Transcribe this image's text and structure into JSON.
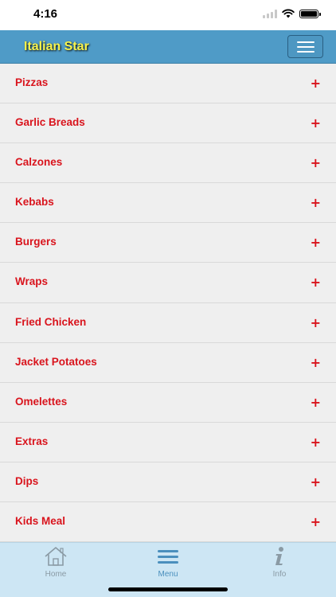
{
  "status_bar": {
    "time": "4:16"
  },
  "header": {
    "title": "Italian Star",
    "menu_toggle_icon": "hamburger-icon"
  },
  "menu": {
    "items": [
      {
        "label": "Pizzas",
        "expand": "+"
      },
      {
        "label": "Garlic Breads",
        "expand": "+"
      },
      {
        "label": "Calzones",
        "expand": "+"
      },
      {
        "label": "Kebabs",
        "expand": "+"
      },
      {
        "label": "Burgers",
        "expand": "+"
      },
      {
        "label": "Wraps",
        "expand": "+"
      },
      {
        "label": "Fried Chicken",
        "expand": "+"
      },
      {
        "label": "Jacket Potatoes",
        "expand": "+"
      },
      {
        "label": "Omelettes",
        "expand": "+"
      },
      {
        "label": "Extras",
        "expand": "+"
      },
      {
        "label": "Dips",
        "expand": "+"
      },
      {
        "label": "Kids Meal",
        "expand": "+"
      }
    ]
  },
  "tabs": {
    "home": {
      "label": "Home",
      "icon": "home-icon"
    },
    "menu": {
      "label": "Menu",
      "icon": "menu-lines-icon",
      "active": true
    },
    "info": {
      "label": "Info",
      "icon": "info-icon"
    }
  },
  "colors": {
    "header_bg": "#4f9bc7",
    "title": "#f7f34d",
    "item_text": "#d9141d",
    "item_bg": "#efefef",
    "tab_bar_bg": "#cde6f4",
    "tab_active": "#4a8fbd",
    "tab_inactive": "#8a9aa4"
  }
}
